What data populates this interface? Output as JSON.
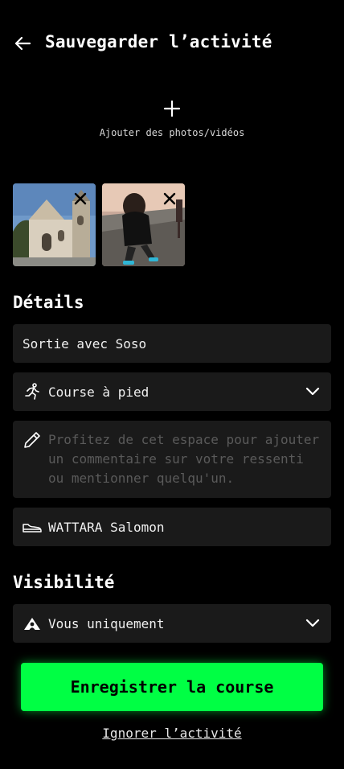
{
  "header": {
    "title": "Sauvegarder l’activité",
    "back_icon": "arrow-left-icon"
  },
  "media": {
    "add_label": "Ajouter des photos/vidéos",
    "add_icon": "plus-icon",
    "photos": [
      {
        "subject": "church",
        "remove_icon": "close-icon"
      },
      {
        "subject": "runners",
        "remove_icon": "close-icon"
      }
    ]
  },
  "details": {
    "section_title": "Détails",
    "activity_title": "Sortie avec Soso",
    "sport": {
      "icon": "running-person-icon",
      "value": "Course à pied",
      "dropdown_icon": "chevron-down-icon"
    },
    "comment": {
      "icon": "pencil-icon",
      "placeholder": "Profitez de cet espace pour ajouter un commentaire sur votre ressenti ou mentionner quelqu'un."
    },
    "gear": {
      "icon": "shoe-icon",
      "value": "WATTARA Salomon"
    }
  },
  "visibility": {
    "section_title": "Visibilité",
    "icon": "mountain-person-icon",
    "value": "Vous uniquement",
    "dropdown_icon": "chevron-down-icon"
  },
  "actions": {
    "save_label": "Enregistrer la course",
    "ignore_label": "Ignorer l’activité"
  },
  "colors": {
    "background": "#000000",
    "field_background": "#1a1a1a",
    "accent": "#00ff44",
    "placeholder": "#5a5a5a"
  }
}
